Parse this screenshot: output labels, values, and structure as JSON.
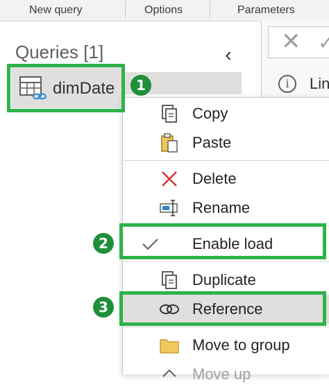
{
  "ribbon": {
    "groups": [
      "New query",
      "Options",
      "Parameters"
    ]
  },
  "queries_pane": {
    "title": "Queries [1]",
    "collapse_glyph": "‹",
    "items": [
      {
        "label": "dimDate",
        "icon": "table-link-icon",
        "selected": true
      }
    ]
  },
  "formula_bar": {
    "cancel_glyph": "✕",
    "commit_glyph": "✓",
    "info_glyph": "i",
    "info_text": "Lin"
  },
  "context_menu": {
    "items": [
      {
        "label": "Copy",
        "icon": "copy-icon"
      },
      {
        "label": "Paste",
        "icon": "paste-icon"
      },
      {
        "label": "Delete",
        "icon": "delete-icon"
      },
      {
        "label": "Rename",
        "icon": "rename-icon"
      },
      {
        "label": "Enable load",
        "icon": "checkmark-icon",
        "checked": true
      },
      {
        "label": "Duplicate",
        "icon": "duplicate-icon"
      },
      {
        "label": "Reference",
        "icon": "link-icon",
        "highlighted": true
      },
      {
        "label": "Move to group",
        "icon": "folder-icon"
      },
      {
        "label": "Move up",
        "icon": "chevron-up-icon"
      }
    ]
  },
  "callouts": [
    "1",
    "2",
    "3"
  ],
  "colors": {
    "highlight": "#2eb34a",
    "badge": "#1f8f3a",
    "delete_red": "#d13438",
    "folder_yellow": "#f2c75c"
  }
}
